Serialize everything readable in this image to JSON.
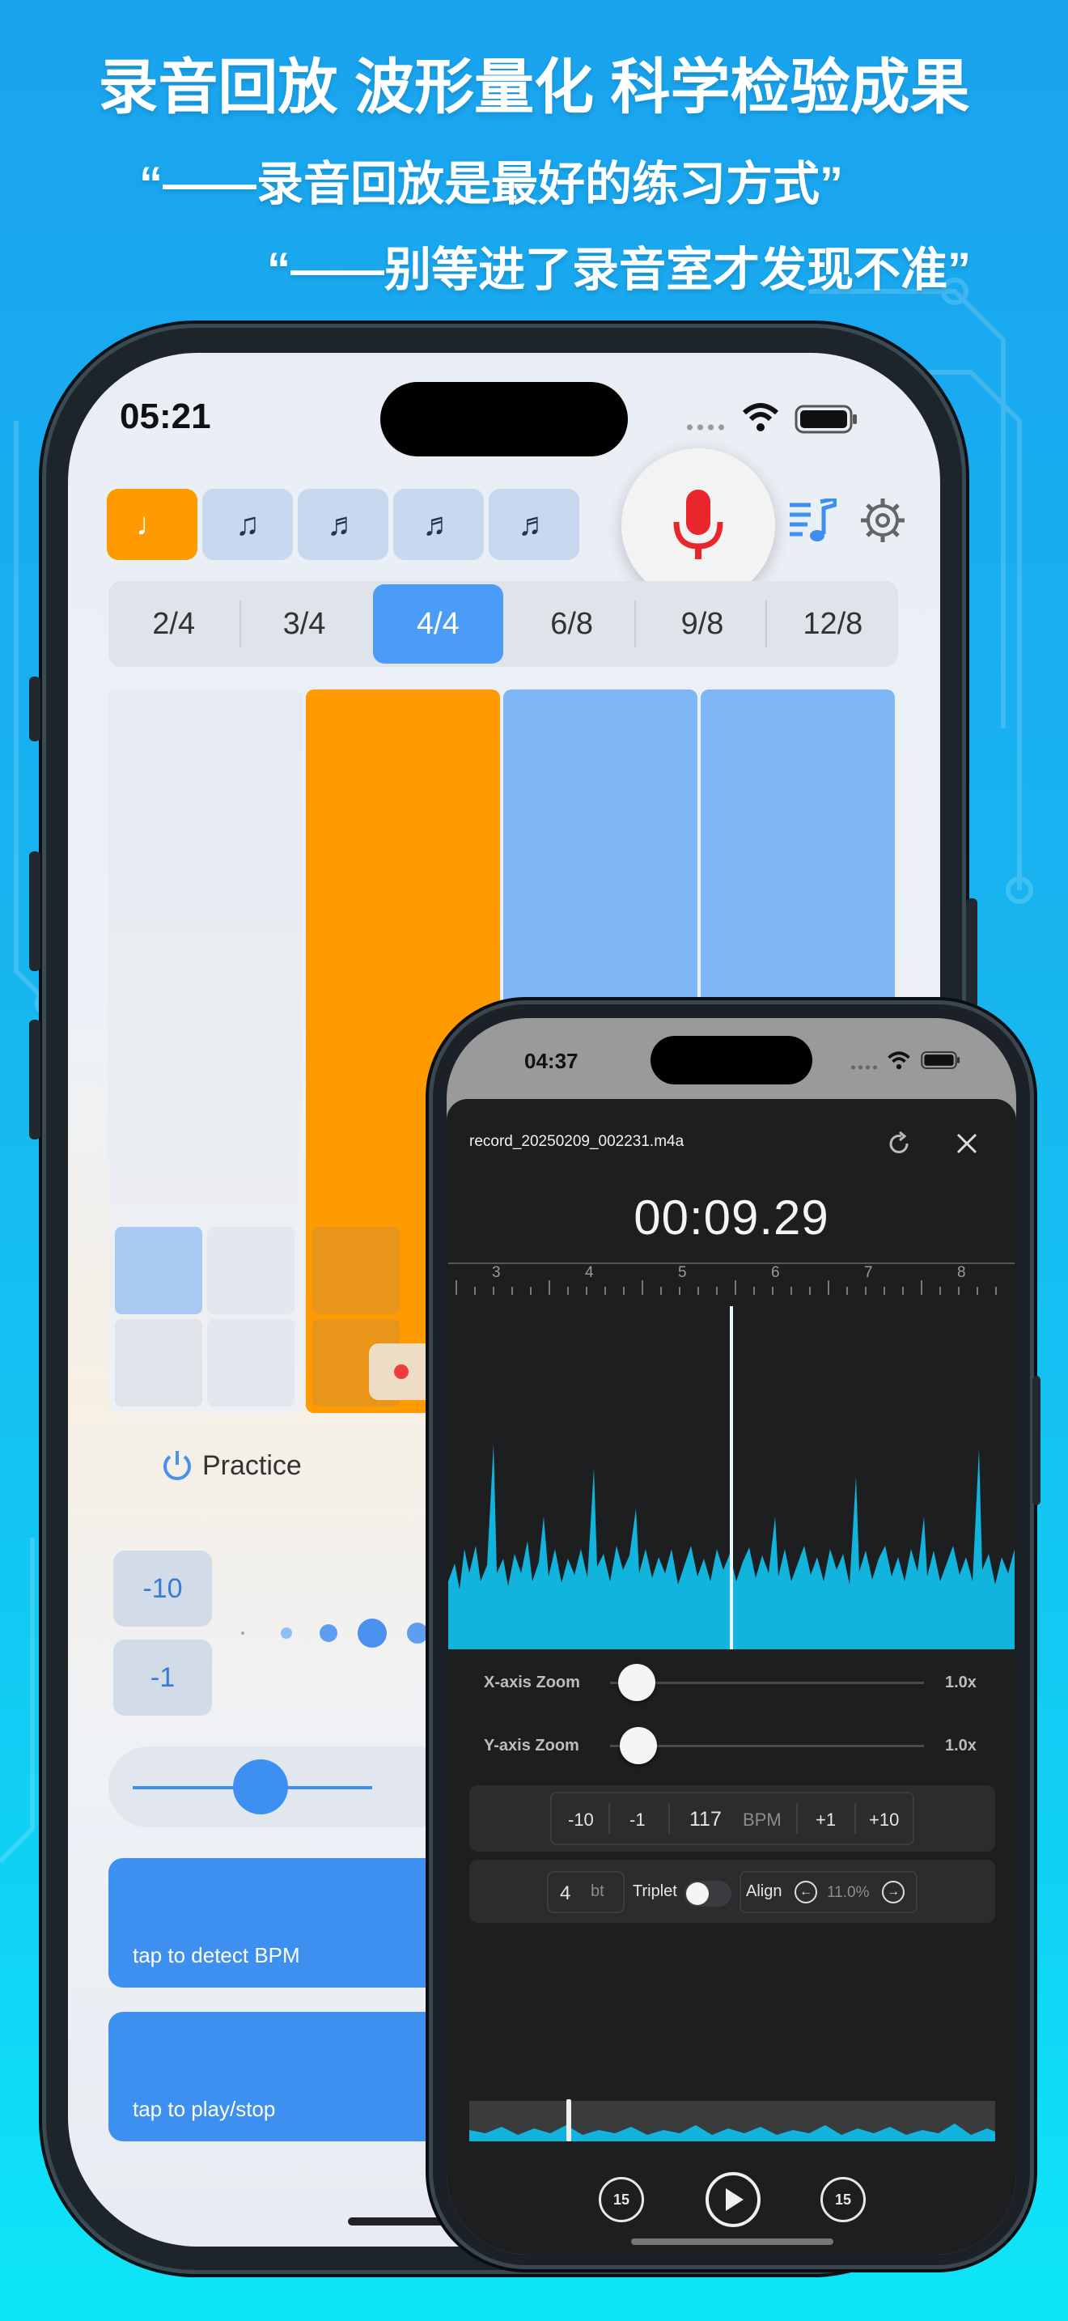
{
  "headline": {
    "line1": "录音回放  波形量化  科学检验成果",
    "line2": "“——录音回放是最好的练习方式”",
    "line3": "“——别等进了录音室才发现不准”"
  },
  "phone_main": {
    "status_time": "05:21",
    "note_buttons": [
      "♩",
      "♫",
      "♬",
      "♬",
      "♬"
    ],
    "time_signatures": [
      "2/4",
      "3/4",
      "4/4",
      "6/8",
      "9/8",
      "12/8"
    ],
    "selected_time_signature": "4/4",
    "practice_label": "Practice",
    "step_buttons": [
      "-10",
      "-1"
    ],
    "tempo_slider_fraction": 0.2,
    "detect_bpm_hint": "tap to detect BPM",
    "play_stop_hint": "tap to play/stop",
    "colors": {
      "accent_orange": "#ff9a00",
      "accent_blue": "#3d8ff0",
      "beat_light_blue": "#7fb6f6"
    }
  },
  "phone_player": {
    "status_time": "04:37",
    "file_name": "record_20250209_002231.m4a",
    "elapsed_time": "00:09.29",
    "ruler_labels": [
      "3",
      "4",
      "5",
      "6",
      "7",
      "8"
    ],
    "x_zoom": {
      "label": "X-axis Zoom",
      "value": "1.0x"
    },
    "y_zoom": {
      "label": "Y-axis Zoom",
      "value": "1.0x"
    },
    "bpm_controls": {
      "minus10": "-10",
      "minus1": "-1",
      "value": "117",
      "unit": "BPM",
      "plus1": "+1",
      "plus10": "+10"
    },
    "beats": {
      "value": "4",
      "unit": "bt"
    },
    "triplet_label": "Triplet",
    "triplet_on": false,
    "align_label": "Align",
    "align_value": "11.0%",
    "skip_back_label": "15",
    "skip_forward_label": "15",
    "colors": {
      "waveform": "#10b4dc",
      "panel_bg": "#1d1e20"
    }
  }
}
